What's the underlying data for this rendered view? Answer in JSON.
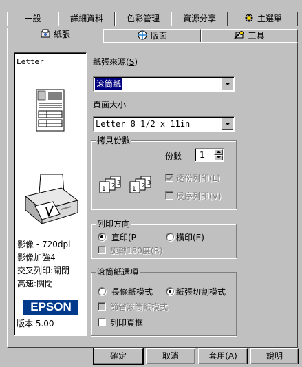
{
  "tabs_row1": [
    {
      "label": "一般"
    },
    {
      "label": "詳細資料"
    },
    {
      "label": "色彩管理"
    },
    {
      "label": "資源分享"
    },
    {
      "label": "主選單",
      "icon": "main-menu-icon"
    }
  ],
  "tabs_row2": [
    {
      "label": "紙張",
      "icon": "paper-icon",
      "active": true
    },
    {
      "label": "版面",
      "icon": "layout-icon"
    },
    {
      "label": "工具",
      "icon": "tools-icon"
    }
  ],
  "preview": {
    "paper_name": "Letter",
    "info": [
      "影像 - 720dpi",
      "影像加強4",
      "交叉列印:關閉",
      "高速:關閉"
    ],
    "brand": "EPSON",
    "version": "版本 5.00"
  },
  "paper_source": {
    "label": "紙張來源(",
    "hotkey": "S",
    "label_end": ")",
    "value": "滾筒紙"
  },
  "paper_size": {
    "label": "頁面大小",
    "value": "Letter 8 1/2 x 11in"
  },
  "copies": {
    "group_title": "拷貝份數",
    "count_label": "份數",
    "count_value": "1",
    "collate_label": "逐份列印(L)",
    "collate_checked": true,
    "reverse_label": "反序列印(V)",
    "reverse_checked": false,
    "collate_icon_digits": [
      "1",
      "2",
      "3"
    ]
  },
  "orientation": {
    "group_title": "列印方向",
    "portrait_label": "直印(P",
    "landscape_label": "橫印(E)",
    "portrait_selected": true,
    "rotate_label": "旋轉180度(R)",
    "rotate_checked": false
  },
  "roll_paper": {
    "group_title": "滾筒紙選項",
    "banner_label": "長條紙模式",
    "cut_label": "紙張切割模式",
    "cut_selected": true,
    "save_label": "節省滾筒紙模式",
    "save_checked": false,
    "border_label": "列印頁框",
    "border_checked": false
  },
  "buttons": {
    "ok": "確定",
    "cancel": "取消",
    "apply": "套用(A)",
    "help": "說明"
  },
  "colors": {
    "dialog_bg": "#c0c0c0",
    "selection": "#000080",
    "epson_blue": "#003a8c"
  }
}
